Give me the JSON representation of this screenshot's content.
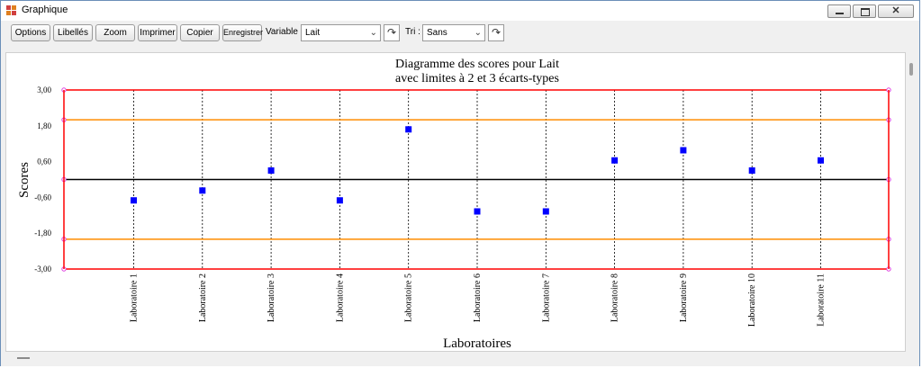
{
  "window": {
    "title": "Graphique"
  },
  "toolbar": {
    "options_label": "Options",
    "libelles_label": "Libellés",
    "zoom_label": "Zoom",
    "imprimer_label": "Imprimer",
    "copier_label": "Copier",
    "enregistrer_label": "Enregistrer",
    "variable_label": "Variable :",
    "variable_value": "Lait",
    "tri_label": "Tri :",
    "tri_value": "Sans"
  },
  "colors": {
    "limit3": "#ff0000",
    "limit2": "#ff8c00",
    "center": "#000000",
    "point": "#0000ff",
    "marker": "#e040e0"
  },
  "chart_data": {
    "type": "scatter",
    "title": "Diagramme des scores pour Lait",
    "subtitle": "avec limites à 2 et 3 écarts-types",
    "xlabel": "Laboratoires",
    "ylabel": "Scores",
    "ylim": [
      -3,
      3
    ],
    "yticks": [
      "3,00",
      "1,80",
      "0,60",
      "-0,60",
      "-1,80",
      "-3,00"
    ],
    "ytick_values": [
      3,
      1.8,
      0.6,
      -0.6,
      -1.8,
      -3
    ],
    "categories": [
      "Laboratoire 1",
      "Laboratoire 2",
      "Laboratoire 3",
      "Laboratoire 4",
      "Laboratoire 5",
      "Laboratoire 6",
      "Laboratoire 7",
      "Laboratoire 8",
      "Laboratoire 9",
      "Laboratoire 10",
      "Laboratoire 11"
    ],
    "values": [
      -0.7,
      -0.37,
      0.3,
      -0.7,
      1.68,
      -1.07,
      -1.07,
      0.64,
      0.98,
      0.3,
      0.64
    ],
    "limits": {
      "upper3": 3,
      "upper2": 2,
      "center": 0,
      "lower2": -2,
      "lower3": -3
    },
    "grid": false
  }
}
